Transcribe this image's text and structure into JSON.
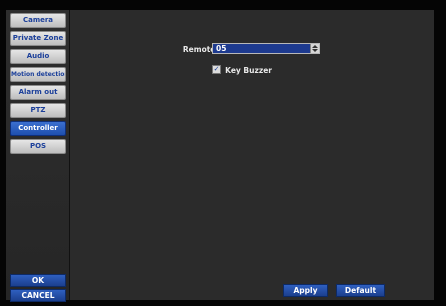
{
  "sidebar": {
    "items": [
      {
        "label": "Camera"
      },
      {
        "label": "Private Zone"
      },
      {
        "label": "Audio"
      },
      {
        "label": "Motion detection"
      },
      {
        "label": "Alarm out"
      },
      {
        "label": "PTZ"
      },
      {
        "label": "Controller"
      },
      {
        "label": "POS"
      }
    ],
    "active_item": "Controller",
    "ok_label": "OK",
    "cancel_label": "CANCEL"
  },
  "controller": {
    "remote_id_label": "Remote Controller ID",
    "remote_id_value": "05",
    "key_buzzer_label": "Key Buzzer",
    "key_buzzer_checked": true,
    "checkmark": "☑"
  },
  "actions": {
    "apply_label": "Apply",
    "default_label": "Default"
  },
  "colors": {
    "accent": "#1e4fae",
    "menu_text": "#1b3f9a"
  }
}
